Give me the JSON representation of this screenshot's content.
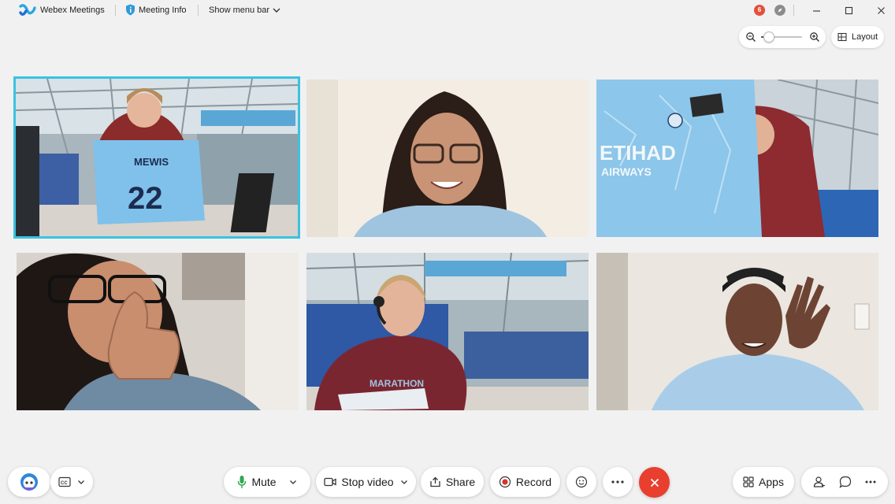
{
  "titlebar": {
    "app_title": "Webex Meetings",
    "info_title": "Meeting Info",
    "menu_toggle": "Show menu bar",
    "notification_count": "6",
    "icons": [
      "webex-logo-icon",
      "shield-info-icon",
      "chevron-down-icon",
      "notification-badge",
      "compass-icon",
      "minimize-icon",
      "maximize-icon",
      "close-icon"
    ]
  },
  "view_controls": {
    "zoom_level": 0.2,
    "layout_label": "Layout"
  },
  "participants": [
    {
      "position": 1,
      "active_speaker": true
    },
    {
      "position": 2,
      "active_speaker": false
    },
    {
      "position": 3,
      "active_speaker": false
    },
    {
      "position": 4,
      "active_speaker": false
    },
    {
      "position": 5,
      "active_speaker": false
    },
    {
      "position": 6,
      "active_speaker": false
    }
  ],
  "toolbar": {
    "mute_label": "Mute",
    "stop_video_label": "Stop video",
    "share_label": "Share",
    "record_label": "Record",
    "apps_label": "Apps"
  },
  "colors": {
    "active_speaker_border": "#39c3e0",
    "leave_button": "#e83f2e",
    "mic_green": "#2fa84f",
    "record_red": "#d9342b",
    "notification_badge": "#e3503b"
  }
}
